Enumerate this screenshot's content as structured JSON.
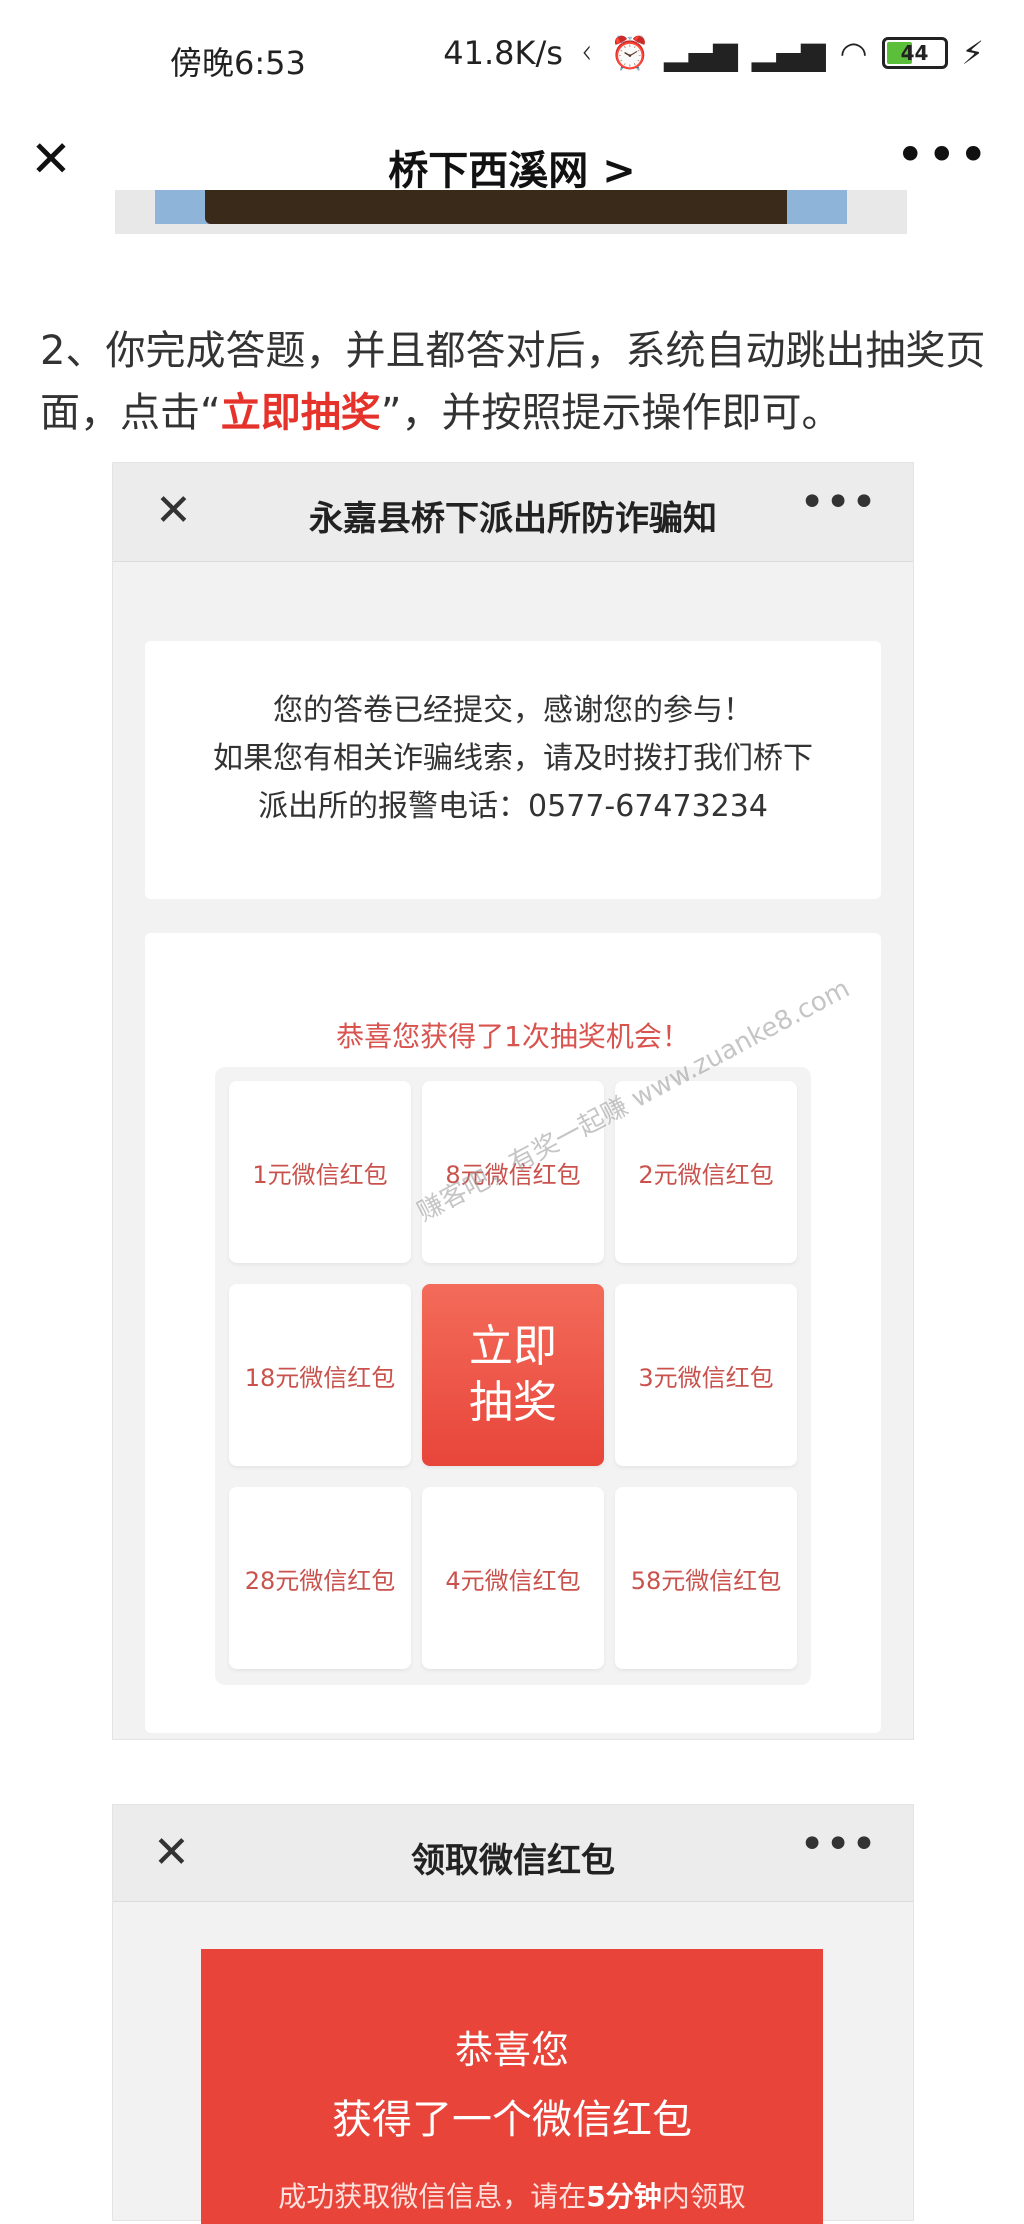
{
  "status": {
    "time": "傍晚6:53",
    "speed": "41.8K/s",
    "battery": "44",
    "battery_level": 0.44
  },
  "nav": {
    "title": "桥下西溪网 >"
  },
  "content": {
    "step_prefix": "2、你完成答题，并且都答对后，系统自动跳出抽奖页面，点击“",
    "step_highlight": "立即抽奖",
    "step_suffix": "”，并按照提示操作即可。"
  },
  "shot1": {
    "title": "永嘉县桥下派出所防诈骗知",
    "notice_lines": [
      "您的答卷已经提交，感谢您的参与！",
      "如果您有相关诈骗线索，请及时拨打我们桥下",
      "派出所的报警电话：0577-67473234"
    ],
    "congrats": "恭喜您获得了1次抽奖机会！",
    "prizes": [
      "1元微信红包",
      "8元微信红包",
      "2元微信红包",
      "18元微信红包",
      "立即\n抽奖",
      "3元微信红包",
      "28元微信红包",
      "4元微信红包",
      "58元微信红包"
    ],
    "draw_button_line1": "立即",
    "draw_button_line2": "抽奖",
    "watermark": "赚客吧，有奖一起赚 www.zuanke8.com"
  },
  "shot2": {
    "title": "领取微信红包",
    "line1": "恭喜您",
    "line2": "获得了一个微信红包",
    "line3_a": "成功获取微信信息，请在",
    "line3_b": "5分钟",
    "line3_c": "内领取"
  }
}
